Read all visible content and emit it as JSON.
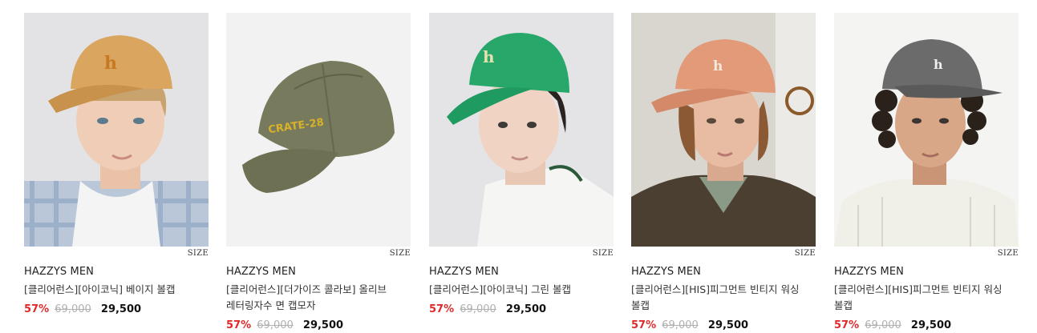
{
  "products": [
    {
      "brand": "HAZZYS MEN",
      "name": "[클리어런스][아이코닉] 베이지 볼캡",
      "size_label": "SIZE",
      "discount": "57%",
      "original_price": "69,000",
      "sale_price": "29,500",
      "cap_color": "#d9a55f",
      "logo_color": "#c87820",
      "bg_color": "#e3e3e5"
    },
    {
      "brand": "HAZZYS MEN",
      "name": "[클리어런스][더가이즈 콜라보] 올리브 레터링자수 면 캡모자",
      "size_label": "SIZE",
      "discount": "57%",
      "original_price": "69,000",
      "sale_price": "29,500",
      "cap_color": "#777a5c",
      "logo_text": "CRATE-28",
      "logo_color": "#d9b22a",
      "bg_color": "#f2f2f2"
    },
    {
      "brand": "HAZZYS MEN",
      "name": "[클리어런스][아이코닉] 그린 볼캡",
      "size_label": "SIZE",
      "discount": "57%",
      "original_price": "69,000",
      "sale_price": "29,500",
      "cap_color": "#27a86a",
      "logo_color": "#e9e0b0",
      "bg_color": "#e4e4e6"
    },
    {
      "brand": "HAZZYS MEN",
      "name": "[클리어런스][HIS]피그먼트 빈티지 워싱 볼캡",
      "size_label": "SIZE",
      "discount": "57%",
      "original_price": "69,000",
      "sale_price": "29,500",
      "cap_color": "#e39a78",
      "logo_color": "#f3e8dc",
      "bg_color": "#d9d6d0"
    },
    {
      "brand": "HAZZYS MEN",
      "name": "[클리어런스][HIS]피그먼트 빈티지 워싱 볼캡",
      "size_label": "SIZE",
      "discount": "57%",
      "original_price": "69,000",
      "sale_price": "29,500",
      "cap_color": "#6b6b6b",
      "logo_color": "#efefef",
      "bg_color": "#f4f4f3"
    }
  ]
}
